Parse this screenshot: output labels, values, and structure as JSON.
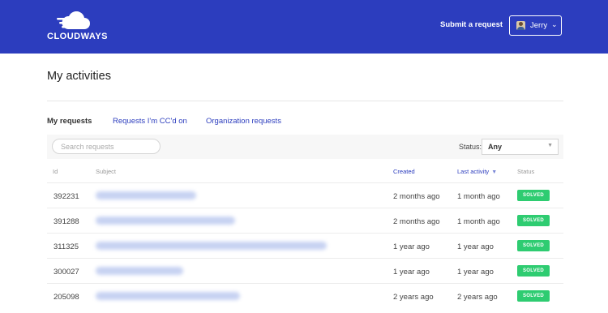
{
  "header": {
    "logo_text": "CLOUDWAYS",
    "submit_request_label": "Submit a request",
    "user_name": "Jerry",
    "colors": {
      "brand": "#2c3dbe"
    }
  },
  "page": {
    "title": "My activities",
    "tabs": [
      {
        "label": "My requests",
        "active": true
      },
      {
        "label": "Requests I'm CC'd on",
        "active": false
      },
      {
        "label": "Organization requests",
        "active": false
      }
    ]
  },
  "filters": {
    "search_placeholder": "Search requests",
    "status_label": "Status:",
    "status_value": "Any"
  },
  "table": {
    "columns": [
      "Id",
      "Subject",
      "Created",
      "Last activity",
      "Status"
    ],
    "sort_indicator": "▼",
    "rows": [
      {
        "id": "392231",
        "created": "2 months ago",
        "last_activity": "1 month ago",
        "status": "SOLVED"
      },
      {
        "id": "391288",
        "created": "2 months ago",
        "last_activity": "1 month ago",
        "status": "SOLVED"
      },
      {
        "id": "311325",
        "created": "1 year ago",
        "last_activity": "1 year ago",
        "status": "SOLVED"
      },
      {
        "id": "300027",
        "created": "1 year ago",
        "last_activity": "1 year ago",
        "status": "SOLVED"
      },
      {
        "id": "205098",
        "created": "2 years ago",
        "last_activity": "2 years ago",
        "status": "SOLVED"
      }
    ],
    "status_color": "#2ecc71"
  }
}
